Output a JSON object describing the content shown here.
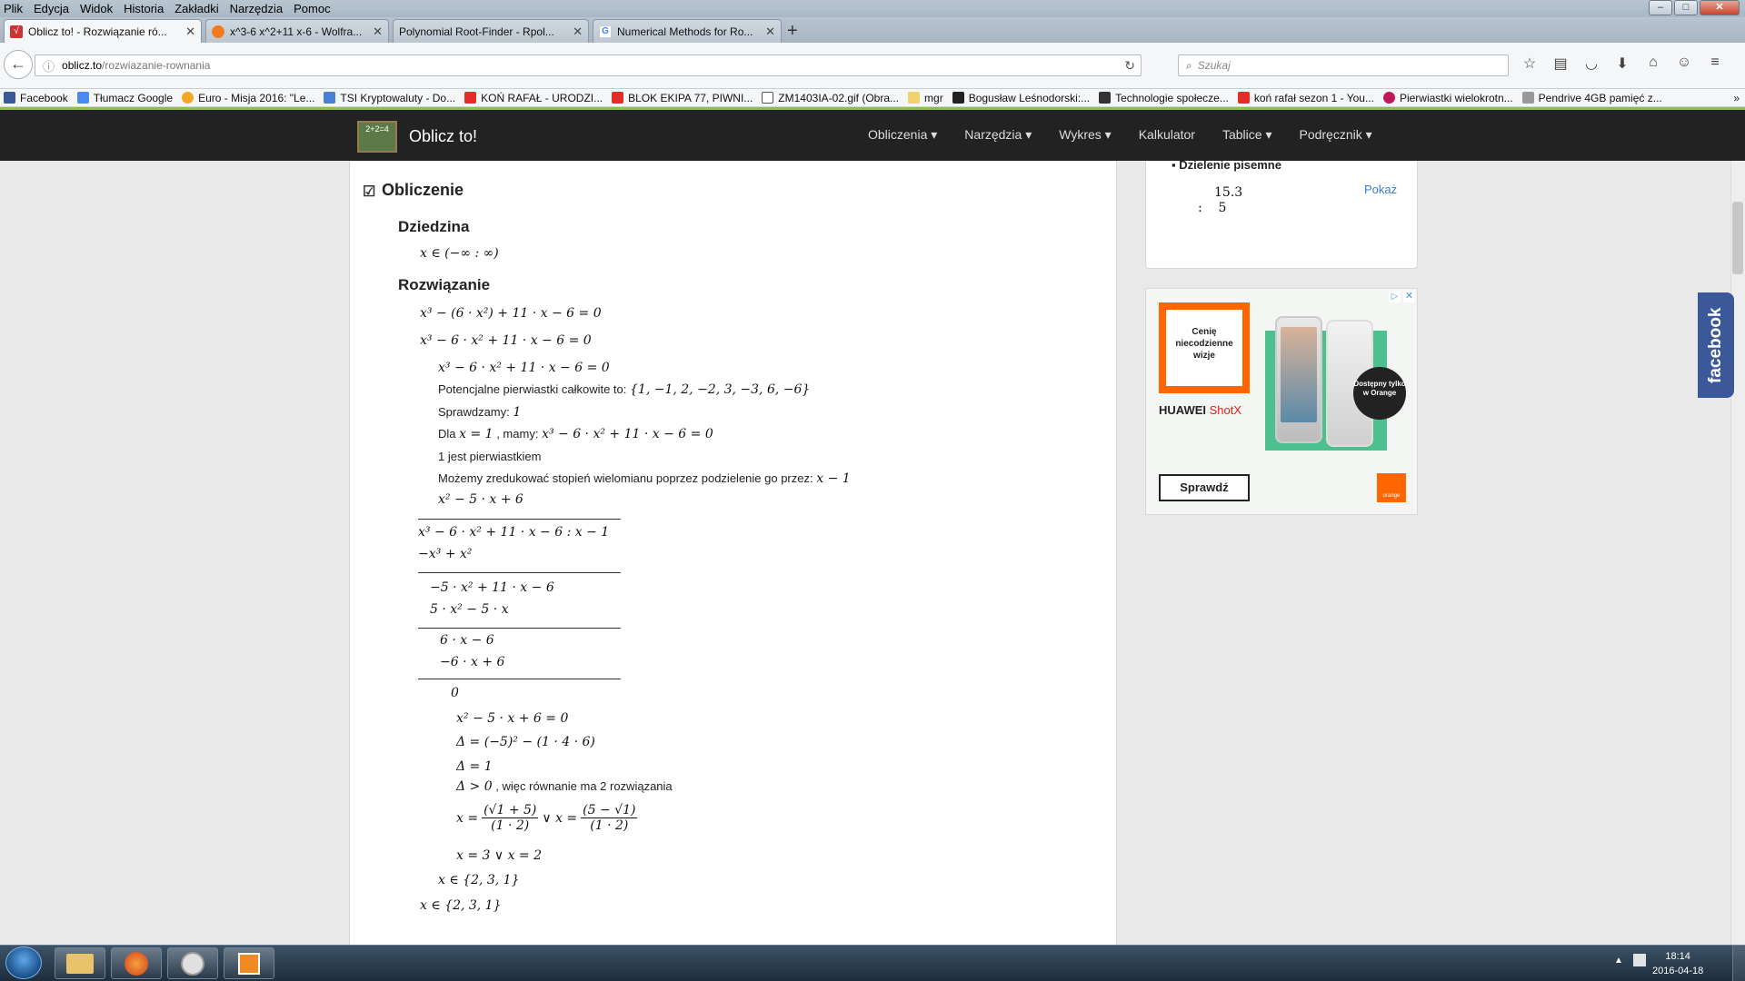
{
  "menubar": {
    "items": [
      "Plik",
      "Edycja",
      "Widok",
      "Historia",
      "Zakładki",
      "Narzędzia",
      "Pomoc"
    ]
  },
  "tabs": [
    {
      "label": "Oblicz to! - Rozwiązanie ró...",
      "active": true
    },
    {
      "label": "x^3-6 x^2+11 x-6 - Wolfra...",
      "active": false
    },
    {
      "label": "Polynomial Root-Finder - Rpol...",
      "active": false
    },
    {
      "label": "Numerical Methods for Ro...",
      "active": false
    }
  ],
  "url": {
    "host": "oblicz.to",
    "path": "/rozwiazanie-rownania"
  },
  "search": {
    "placeholder": "Szukaj"
  },
  "bookmarks": [
    "Facebook",
    "Tłumacz Google",
    "Euro - Misja 2016: \"Le...",
    "TSI Kryptowaluty - Do...",
    "KOŃ RAFAŁ - URODZI...",
    "BLOK EKIPA 77, PIWNI...",
    "ZM1403IA-02.gif (Obra...",
    "mgr",
    "Bogusław Leśnodorski:...",
    "Technologie społecze...",
    "koń rafał sezon 1 - You...",
    "Pierwiastki wielokrotn...",
    "Pendrive 4GB pamięć z..."
  ],
  "site": {
    "brand": "Oblicz to!",
    "logo_text": "2+2=4",
    "menu": [
      "Obliczenia ▾",
      "Narzędzia ▾",
      "Wykres ▾",
      "Kalkulator",
      "Tablice ▾",
      "Podręcznik ▾"
    ]
  },
  "calc": {
    "section_title": "Obliczenie",
    "domain_title": "Dziedzina",
    "domain": "x ∈ (−∞ : ∞)",
    "solution_title": "Rozwiązanie",
    "eq1": "x³ − (6 · x²) + 11 · x − 6 = 0",
    "eq2": "x³ − 6 · x² + 11 · x − 6 = 0",
    "eq3": "x³ − 6 · x² + 11 · x − 6 = 0",
    "candidates_label": "Potencjalne pierwiastki całkowite to:",
    "candidates": "{1, −1, 2, −2, 3, −3, 6, −6}",
    "check_label": "Sprawdzamy:",
    "check_value": "1",
    "for_label": "Dla",
    "for_value": "x = 1",
    "we_have": ", mamy:",
    "eq4": "x³ − 6 · x² + 11 · x − 6 = 0",
    "is_root": "1 jest pierwiastkiem",
    "reduce_label": "Możemy zredukować stopień wielomianu poprzez podzielenie go przez:",
    "divisor": "x − 1",
    "quotient": "x² − 5 · x + 6",
    "div_row1": "x³ − 6 · x² + 11 · x − 6 : x − 1",
    "div_row2": "−x³ + x²",
    "div_row3": "−5 · x² + 11 · x − 6",
    "div_row4": "5 · x² − 5 · x",
    "div_row5": "6 · x − 6",
    "div_row6": "−6 · x + 6",
    "div_row7": "0",
    "q1": "x² − 5 · x + 6 = 0",
    "q2": "Δ = (−5)² − (1 · 4 · 6)",
    "q3": "Δ = 1",
    "q4": "Δ > 0",
    "q4_text": ", więc równanie ma 2 rozwiązania",
    "x_eq": "x =",
    "frac1_num": "(√1 + 5)",
    "frac_den": "(1 · 2)",
    "or_x": "∨ x =",
    "frac2_num": "(5 − √1)",
    "q6": "x = 3 ∨ x = 2",
    "res1": "x ∈ {2, 3, 1}",
    "res2": "x ∈ {2, 3, 1}"
  },
  "sidebar": {
    "long_division_title": "Dzielenie pisemne",
    "div_top": "15.3",
    "div_bottom": ":    5",
    "show_link": "Pokaż",
    "ad": {
      "badge": "Cenię niecodzienne wizje",
      "brand": "HUAWEI",
      "model": "ShotX",
      "bubble": "Dostępny tylko w Orange",
      "cta": "Sprawdź",
      "operator": "orange"
    }
  },
  "facebook_tab": "facebook",
  "taskbar": {
    "time": "18:14",
    "date": "2016-04-18"
  }
}
